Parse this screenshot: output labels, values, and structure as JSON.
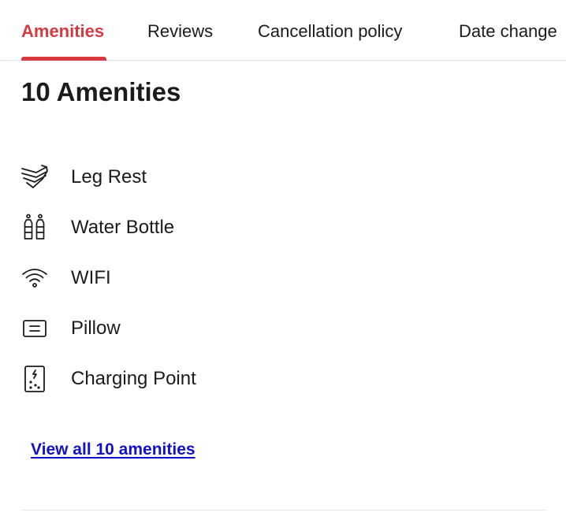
{
  "tabs": [
    {
      "label": "Amenities",
      "active": true
    },
    {
      "label": "Reviews",
      "active": false
    },
    {
      "label": "Cancellation policy",
      "active": false
    },
    {
      "label": "Date change",
      "active": false
    }
  ],
  "accent_color": "#d43a3f",
  "link_color": "#1010c8",
  "section": {
    "title": "10 Amenities",
    "items": [
      {
        "icon": "leg-rest-icon",
        "label": "Leg Rest"
      },
      {
        "icon": "water-bottle-icon",
        "label": "Water Bottle"
      },
      {
        "icon": "wifi-icon",
        "label": "WIFI"
      },
      {
        "icon": "pillow-icon",
        "label": "Pillow"
      },
      {
        "icon": "charging-point-icon",
        "label": "Charging Point"
      }
    ],
    "view_all_label": "View all 10 amenities"
  }
}
